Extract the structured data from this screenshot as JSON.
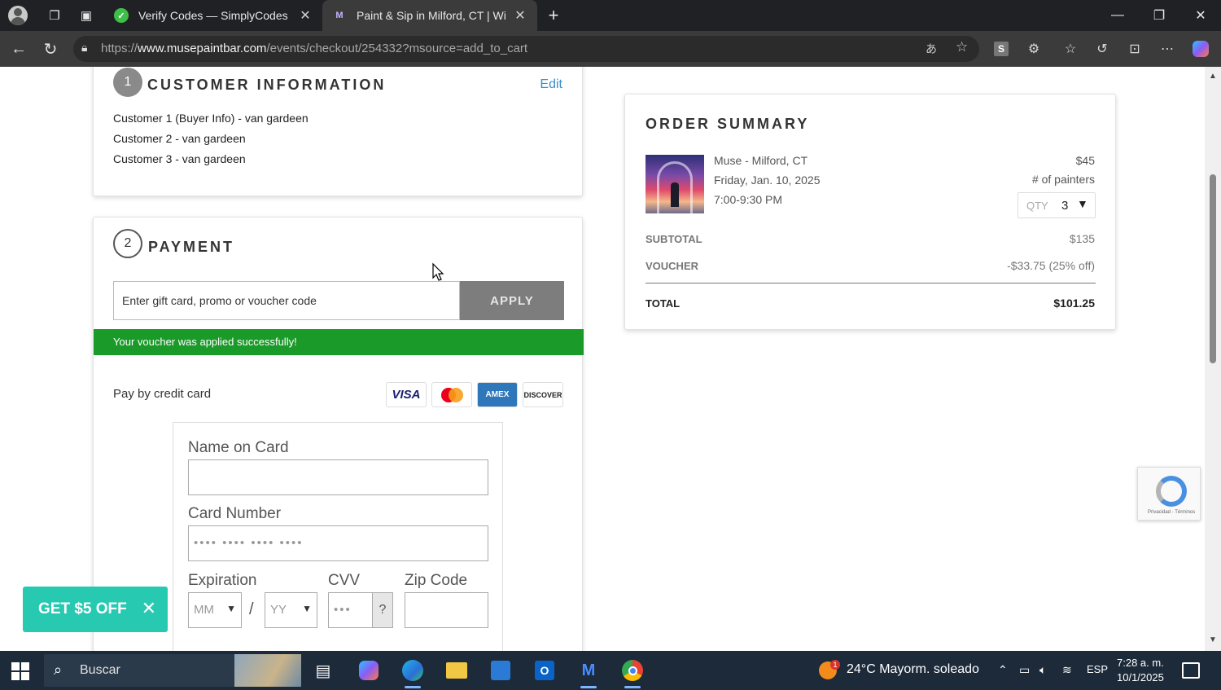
{
  "browser": {
    "tabs": [
      {
        "title": "Verify Codes — SimplyCodes",
        "active": false
      },
      {
        "title": "Paint & Sip in Milford, CT | Wine & ",
        "active": true
      }
    ],
    "url_prefix": "https://",
    "url_domain": "www.musepaintbar.com",
    "url_path": "/events/checkout/254332?msource=add_to_cart"
  },
  "customer_info": {
    "step": "1",
    "title": "CUSTOMER INFORMATION",
    "edit_label": "Edit",
    "customers": [
      "Customer 1 (Buyer Info) - van gardeen",
      "Customer 2 - van gardeen",
      "Customer 3 - van gardeen"
    ]
  },
  "payment": {
    "step": "2",
    "title": "PAYMENT",
    "promo_placeholder": "Enter gift card, promo or voucher code",
    "apply_label": "APPLY",
    "success_message": "Your voucher was applied successfully!",
    "pay_by_label": "Pay by credit card",
    "card_brands": [
      "VISA",
      "MasterCard",
      "AMEX",
      "DISCOVER"
    ],
    "form": {
      "name_label": "Name on Card",
      "name_value": "",
      "number_label": "Card Number",
      "number_placeholder": "•••• •••• •••• ••••",
      "expiration_label": "Expiration",
      "month_value": "MM",
      "year_value": "YY",
      "separator": "/",
      "cvv_label": "CVV",
      "cvv_placeholder": "•••",
      "cvv_help": "?",
      "zip_label": "Zip Code",
      "zip_value": ""
    }
  },
  "order_summary": {
    "title": "ORDER SUMMARY",
    "location": "Muse - Milford, CT",
    "date": "Friday, Jan. 10, 2025",
    "time": "7:00-9:30 PM",
    "price": "$45",
    "painters_label": "# of painters",
    "qty_label": "QTY",
    "qty_value": "3",
    "subtotal_label": "SUBTOTAL",
    "subtotal_value": "$135",
    "voucher_label": "VOUCHER",
    "voucher_value": "-$33.75 (25% off)",
    "total_label": "TOTAL",
    "total_value": "$101.25"
  },
  "promo_popup": {
    "label": "GET $5 OFF",
    "close": "✕"
  },
  "recaptcha": {
    "text": "Privacidad - Términos"
  },
  "taskbar": {
    "search_placeholder": "Buscar",
    "weather_badge": "1",
    "weather": "24°C  Mayorm. soleado",
    "language": "ESP",
    "time": "7:28 a. m.",
    "date": "10/1/2025"
  },
  "colors": {
    "success_green": "#1a9a29",
    "apply_gray": "#7d7d7d",
    "edit_link": "#3a8fc7",
    "promo_teal": "#28c9b1"
  }
}
